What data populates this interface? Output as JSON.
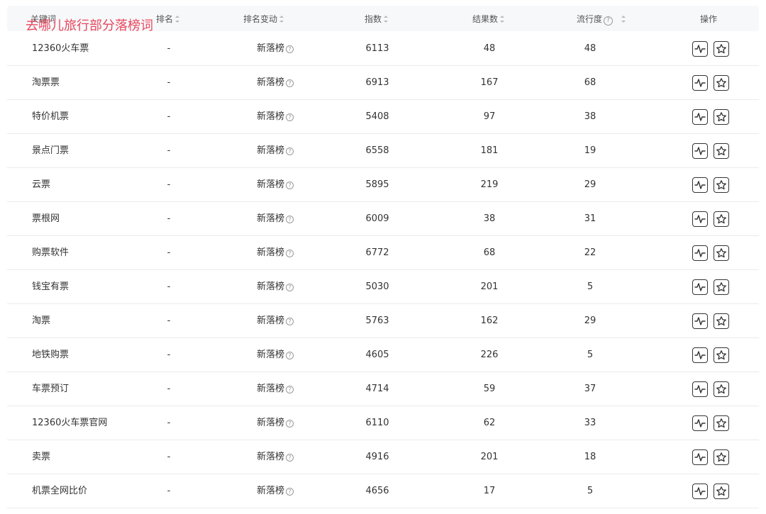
{
  "overlay_title": "去哪儿旅行部分落榜词",
  "columns": {
    "keyword": "关键词",
    "rank": "排名",
    "rank_change": "排名变动",
    "index": "指数",
    "results": "结果数",
    "flow": "流行度",
    "actions": "操作"
  },
  "rows": [
    {
      "keyword": "12360火车票",
      "rank": "-",
      "change": "新落榜",
      "index": "6113",
      "results": "48",
      "flow": "48"
    },
    {
      "keyword": "淘票票",
      "rank": "-",
      "change": "新落榜",
      "index": "6913",
      "results": "167",
      "flow": "68"
    },
    {
      "keyword": "特价机票",
      "rank": "-",
      "change": "新落榜",
      "index": "5408",
      "results": "97",
      "flow": "38"
    },
    {
      "keyword": "景点门票",
      "rank": "-",
      "change": "新落榜",
      "index": "6558",
      "results": "181",
      "flow": "19"
    },
    {
      "keyword": "云票",
      "rank": "-",
      "change": "新落榜",
      "index": "5895",
      "results": "219",
      "flow": "29"
    },
    {
      "keyword": "票根网",
      "rank": "-",
      "change": "新落榜",
      "index": "6009",
      "results": "38",
      "flow": "31"
    },
    {
      "keyword": "购票软件",
      "rank": "-",
      "change": "新落榜",
      "index": "6772",
      "results": "68",
      "flow": "22"
    },
    {
      "keyword": "钱宝有票",
      "rank": "-",
      "change": "新落榜",
      "index": "5030",
      "results": "201",
      "flow": "5"
    },
    {
      "keyword": "淘票",
      "rank": "-",
      "change": "新落榜",
      "index": "5763",
      "results": "162",
      "flow": "29"
    },
    {
      "keyword": "地铁购票",
      "rank": "-",
      "change": "新落榜",
      "index": "4605",
      "results": "226",
      "flow": "5"
    },
    {
      "keyword": "车票预订",
      "rank": "-",
      "change": "新落榜",
      "index": "4714",
      "results": "59",
      "flow": "37"
    },
    {
      "keyword": "12360火车票官网",
      "rank": "-",
      "change": "新落榜",
      "index": "6110",
      "results": "62",
      "flow": "33"
    },
    {
      "keyword": "卖票",
      "rank": "-",
      "change": "新落榜",
      "index": "4916",
      "results": "201",
      "flow": "18"
    },
    {
      "keyword": "机票全网比价",
      "rank": "-",
      "change": "新落榜",
      "index": "4656",
      "results": "17",
      "flow": "5"
    }
  ],
  "icons": {
    "help": "question-circle-icon",
    "sort": "sort-icon",
    "trend": "trend-chart-icon",
    "favorite": "star-icon"
  },
  "colors": {
    "overlay_title": "#e8485e",
    "header_bg": "#f7f8fa",
    "row_divider": "#ebebeb",
    "icon_stroke": "#333333"
  }
}
